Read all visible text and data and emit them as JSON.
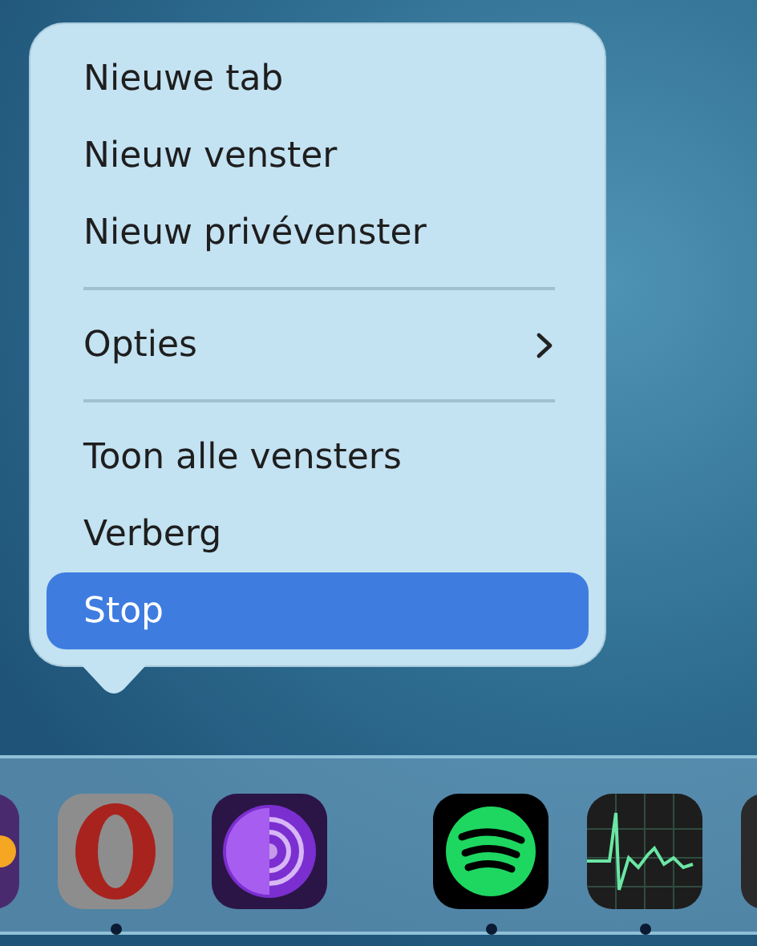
{
  "menu": {
    "items": [
      {
        "kind": "item",
        "label": "Nieuwe tab",
        "selected": false
      },
      {
        "kind": "item",
        "label": "Nieuw venster",
        "selected": false
      },
      {
        "kind": "item",
        "label": "Nieuw privévenster",
        "selected": false
      },
      {
        "kind": "separator"
      },
      {
        "kind": "submenu",
        "label": "Opties",
        "selected": false
      },
      {
        "kind": "separator"
      },
      {
        "kind": "item",
        "label": "Toon alle vensters",
        "selected": false
      },
      {
        "kind": "item",
        "label": "Verberg",
        "selected": false
      },
      {
        "kind": "item",
        "label": "Stop",
        "selected": true
      }
    ]
  },
  "dock": {
    "items": [
      {
        "kind": "partial-left",
        "running": false
      },
      {
        "kind": "opera",
        "running": true
      },
      {
        "kind": "tor",
        "running": false
      },
      {
        "kind": "separator"
      },
      {
        "kind": "spotify",
        "running": true
      },
      {
        "kind": "activity",
        "running": true
      },
      {
        "kind": "partial-right",
        "running": false
      }
    ]
  }
}
